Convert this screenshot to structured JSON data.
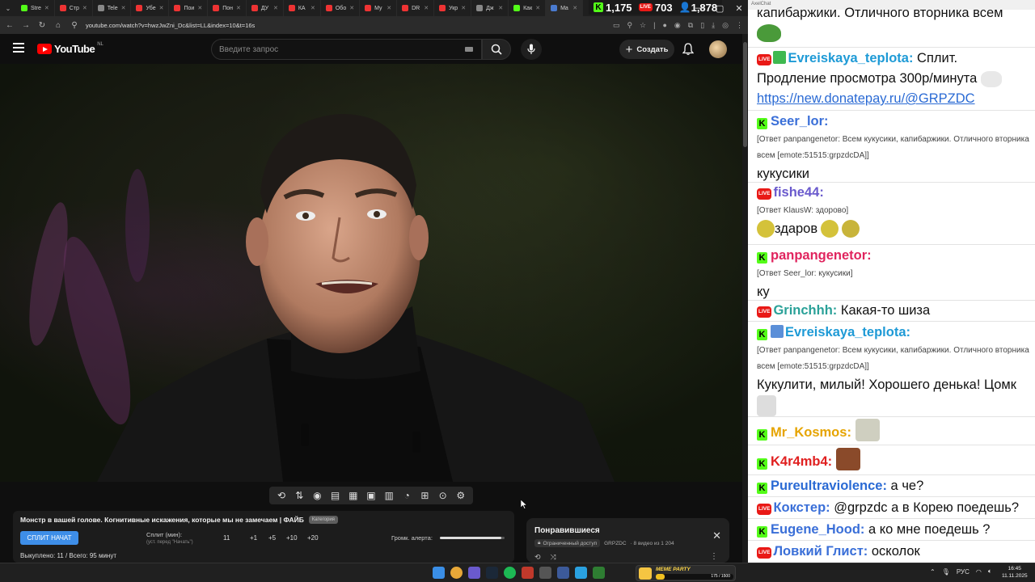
{
  "browser": {
    "tabs": [
      {
        "label": "Stre",
        "color": "#53fc18"
      },
      {
        "label": "Стр",
        "color": "#e33"
      },
      {
        "label": "Tele",
        "color": "#888"
      },
      {
        "label": "Убе",
        "color": "#e33"
      },
      {
        "label": "Пои",
        "color": "#e33"
      },
      {
        "label": "Пон",
        "color": "#e33"
      },
      {
        "label": "ДУ",
        "color": "#e33"
      },
      {
        "label": "КА",
        "color": "#e33"
      },
      {
        "label": "Обо",
        "color": "#e33"
      },
      {
        "label": "Му",
        "color": "#e33"
      },
      {
        "label": "DR",
        "color": "#e33"
      },
      {
        "label": "Укр",
        "color": "#e33"
      },
      {
        "label": "Дж",
        "color": "#888"
      },
      {
        "label": "Как",
        "color": "#53fc18"
      },
      {
        "label": "Ma",
        "color": "#4a7bd0"
      }
    ],
    "url": "youtube.com/watch?v=hwzJwZni_Dc&list=LL&index=10&t=16s"
  },
  "counters": {
    "kick": "1,175",
    "live": "703",
    "viewers": "1,878"
  },
  "youtube": {
    "logo_text": "YouTube",
    "region": "NL",
    "search_placeholder": "Введите запрос",
    "create_label": "Создать"
  },
  "split": {
    "title": "Монстр в вашей голове. Когнитивные искажения, которые мы не замечаем | ФАЙБ",
    "category": "Категория",
    "start_button": "СПЛИТ НАЧАТ",
    "split_label": "Сплит (мин):",
    "split_hint": "(уст. перед \"Начать\")",
    "split_value": "11",
    "plus1": "+1",
    "plus5": "+5",
    "plus10": "+10",
    "plus20": "+20",
    "alert_label": "Громк. алерта:",
    "alert_volume": 0.95,
    "bought": "Выкуплено: 11 / Всего: 95 минут"
  },
  "liked": {
    "title": "Понравившиеся",
    "restricted": "Ограниченный доступ",
    "owner": "GRPZDC",
    "position": "· 8 видео из 1 204"
  },
  "chat": {
    "app_title": "AxelChat",
    "messages": [
      {
        "text_pre": "капибаржики. Отличного вторника всем"
      },
      {
        "user": "Evreiskaya_teplota:",
        "user_color": "#1e9ad6",
        "text": " Сплит. Продление просмотра 300р/минута",
        "link": "https://new.donatepay.ru/@GRPZDC"
      },
      {
        "user": "Seer_lor:",
        "user_color": "#3a6fd8",
        "reply": "[Ответ panpangenetor: Всем кукусики, капибаржики. Отличного вторника всем [emote:51515:grpzdcDA]]",
        "text": "кукусики"
      },
      {
        "user": "fishe44:",
        "user_color": "#6a5acd",
        "reply": "[Ответ KlausW: здорово]",
        "text": "здаров"
      },
      {
        "user": "panpangenetor:",
        "user_color": "#e0245e",
        "reply": "[Ответ Seer_lor: кукусики]",
        "text": "ку"
      },
      {
        "user": "Grinchhh:",
        "user_color": "#2aa198",
        "text": " Какая-то шиза"
      },
      {
        "user": "Evreiskaya_teplota:",
        "user_color": "#1e9ad6",
        "reply": "[Ответ panpangenetor: Всем кукусики, капибаржики. Отличного вторника всем [emote:51515:grpzdcDA]]",
        "text": "Кукулити, милый! Хорошего денька! Цомк"
      },
      {
        "user": "Mr_Kosmos:",
        "user_color": "#e6a400"
      },
      {
        "user": "K4r4mb4:",
        "user_color": "#e02020"
      },
      {
        "user": "Pureultraviolence:",
        "user_color": "#2a6ad4",
        "text": " а че?"
      },
      {
        "user": "Кокстер:",
        "user_color": "#3a6fd8",
        "text": " @grpzdc а в Корею поедешь?"
      },
      {
        "user": "Eugene_Hood:",
        "user_color": "#3a6fd8",
        "text": " а ко мне поедешь ?"
      },
      {
        "user": "Ловкий Глист:",
        "user_color": "#3a6fd8",
        "text": " осколок"
      }
    ]
  },
  "taskbar": {
    "meme_title": "MEME PARTY",
    "meme_count": "175 / 1500",
    "meme_progress": 0.117,
    "lang": "РУС",
    "time": "16:45",
    "date": "11.11.2025"
  }
}
